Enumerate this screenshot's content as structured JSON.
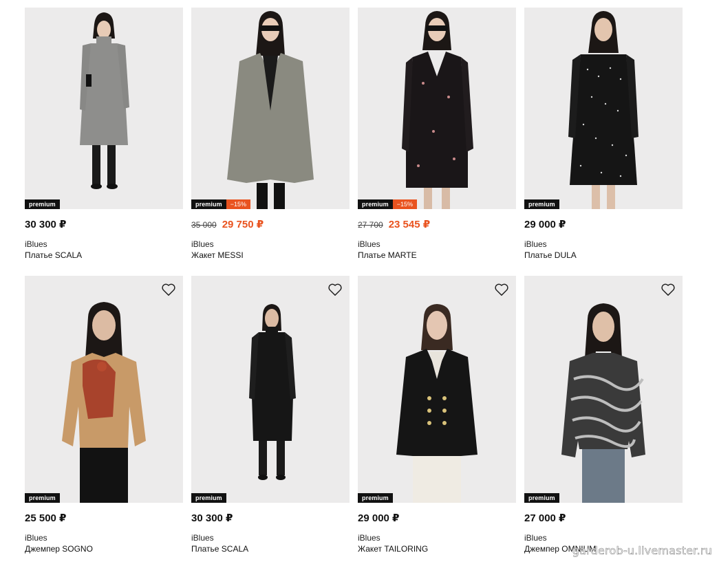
{
  "products": [
    {
      "badge": "premium",
      "discount": "",
      "old_price": "",
      "price": "30 300 ₽",
      "brand": "iBlues",
      "name": "Платье SCALA",
      "garment": "long-gray-dress",
      "garment_color": "#8e8e8c",
      "has_favorite": false
    },
    {
      "badge": "premium",
      "discount": "−15%",
      "old_price": "35 000",
      "price": "29 750 ₽",
      "brand": "iBlues",
      "name": "Жакет MESSI",
      "garment": "check-blazer",
      "garment_color": "#8a8a80",
      "has_favorite": false
    },
    {
      "badge": "premium",
      "discount": "−15%",
      "old_price": "27 700",
      "price": "23 545 ₽",
      "brand": "iBlues",
      "name": "Платье MARTE",
      "garment": "print-dress",
      "garment_color": "#1a1618",
      "has_favorite": false
    },
    {
      "badge": "premium",
      "discount": "",
      "old_price": "",
      "price": "29 000 ₽",
      "brand": "iBlues",
      "name": "Платье DULA",
      "garment": "dot-dress",
      "garment_color": "#151515",
      "has_favorite": false
    },
    {
      "badge": "premium",
      "discount": "",
      "old_price": "",
      "price": "25 500 ₽",
      "brand": "iBlues",
      "name": "Джемпер SOGNO",
      "garment": "camel-sweater",
      "garment_color": "#c89a68",
      "has_favorite": true
    },
    {
      "badge": "premium",
      "discount": "",
      "old_price": "",
      "price": "30 300 ₽",
      "brand": "iBlues",
      "name": "Платье SCALA",
      "garment": "long-black-dress",
      "garment_color": "#161616",
      "has_favorite": true
    },
    {
      "badge": "premium",
      "discount": "",
      "old_price": "",
      "price": "29 000 ₽",
      "brand": "iBlues",
      "name": "Жакет TAILORING",
      "garment": "black-blazer",
      "garment_color": "#151515",
      "has_favorite": true
    },
    {
      "badge": "premium",
      "discount": "",
      "old_price": "",
      "price": "27 000 ₽",
      "brand": "iBlues",
      "name": "Джемпер OMNIUM",
      "garment": "zebra-sweater",
      "garment_color": "#3a3a3a",
      "has_favorite": true
    }
  ],
  "icons": {
    "favorite": "heart-icon"
  },
  "watermark": "garderob-u.livemaster.ru",
  "colors": {
    "accent": "#e9531f",
    "badge_bg": "#111111",
    "photo_bg": "#ecebeb"
  }
}
